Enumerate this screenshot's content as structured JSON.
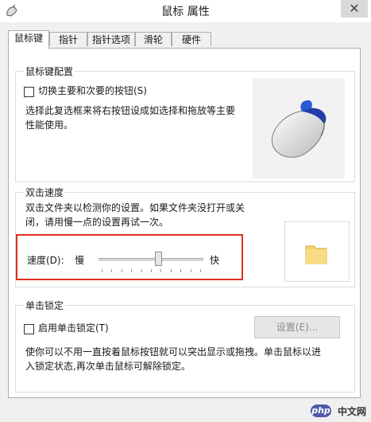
{
  "window": {
    "title": "鼠标 属性",
    "close_glyph": "✕"
  },
  "tabs": [
    {
      "label": "鼠标键",
      "active": true
    },
    {
      "label": "指针",
      "active": false
    },
    {
      "label": "指针选项",
      "active": false
    },
    {
      "label": "滑轮",
      "active": false
    },
    {
      "label": "硬件",
      "active": false
    }
  ],
  "button_config": {
    "group_title": "鼠标键配置",
    "checkbox_label": "切换主要和次要的按钮(S)",
    "checked": false,
    "description_line1": "选择此复选框来将右按钮设成如选择和拖放等主要",
    "description_line2": "性能使用。"
  },
  "double_click": {
    "group_title": "双击速度",
    "description_line1": "双击文件夹以检测你的设置。如果文件夹没打开或关",
    "description_line2": "闭，请用慢一点的设置再试一次。",
    "speed_label": "速度(D):",
    "slow_label": "慢",
    "fast_label": "快",
    "speed_value_fraction": 0.58
  },
  "click_lock": {
    "group_title": "单击锁定",
    "checkbox_label": "启用单击锁定(T)",
    "checked": false,
    "settings_button": "设置(E)...",
    "description_line1": "使你可以不用一直按着鼠标按钮就可以突出显示或拖拽。单击鼠标以进",
    "description_line2": "入锁定状态,再次单击鼠标可解除锁定。"
  },
  "watermark": {
    "logo_text": "php",
    "site_text": "中文网"
  },
  "colors": {
    "highlight_border": "#e0301e",
    "folder_yellow": "#f5d36b",
    "mouse_blue": "#1f3da8"
  }
}
